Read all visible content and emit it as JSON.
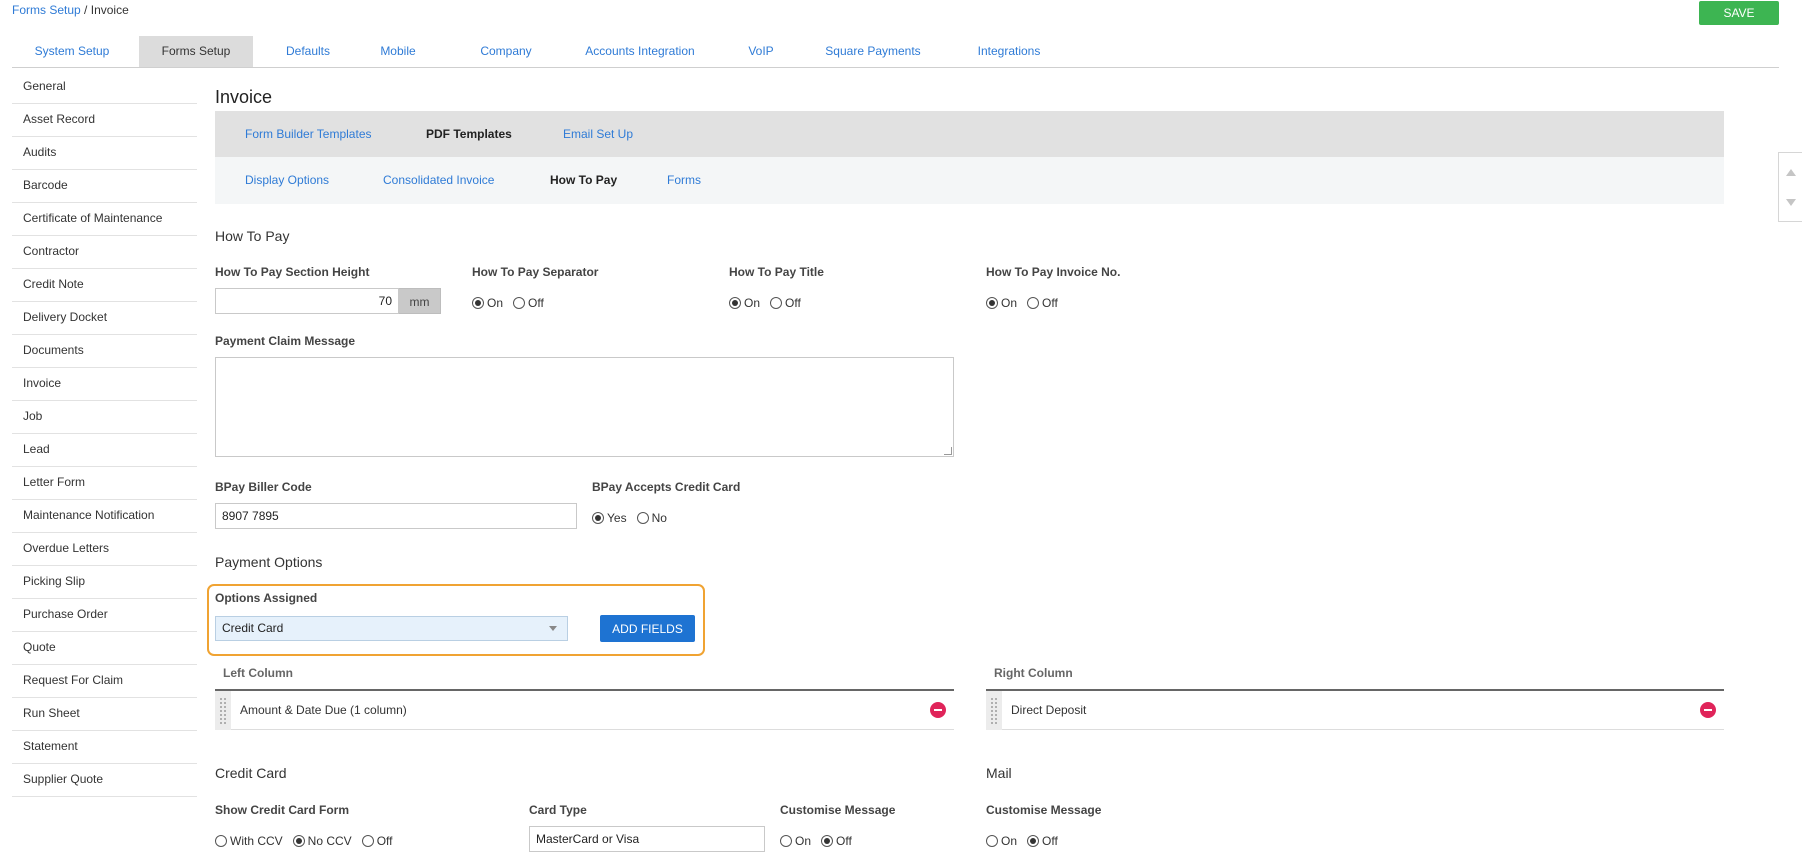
{
  "breadcrumb": {
    "parent": "Forms Setup",
    "separator": "/",
    "current": "Invoice"
  },
  "save_label": "SAVE",
  "main_tabs": [
    {
      "label": "System Setup",
      "active": false
    },
    {
      "label": "Forms Setup",
      "active": true
    },
    {
      "label": "Defaults",
      "active": false
    },
    {
      "label": "Mobile",
      "active": false
    },
    {
      "label": "Company",
      "active": false
    },
    {
      "label": "Accounts Integration",
      "active": false
    },
    {
      "label": "VoIP",
      "active": false
    },
    {
      "label": "Square Payments",
      "active": false
    },
    {
      "label": "Integrations",
      "active": false
    }
  ],
  "sidebar": {
    "items": [
      {
        "label": "General"
      },
      {
        "label": "Asset Record"
      },
      {
        "label": "Audits"
      },
      {
        "label": "Barcode"
      },
      {
        "label": "Certificate of Maintenance"
      },
      {
        "label": "Contractor"
      },
      {
        "label": "Credit Note"
      },
      {
        "label": "Delivery Docket"
      },
      {
        "label": "Documents"
      },
      {
        "label": "Invoice"
      },
      {
        "label": "Job"
      },
      {
        "label": "Lead"
      },
      {
        "label": "Letter Form"
      },
      {
        "label": "Maintenance Notification"
      },
      {
        "label": "Overdue Letters"
      },
      {
        "label": "Picking Slip"
      },
      {
        "label": "Purchase Order"
      },
      {
        "label": "Quote"
      },
      {
        "label": "Request For Claim"
      },
      {
        "label": "Run Sheet"
      },
      {
        "label": "Statement"
      },
      {
        "label": "Supplier Quote"
      }
    ]
  },
  "page_title": "Invoice",
  "sub_tabs": [
    {
      "label": "Form Builder Templates",
      "active": false
    },
    {
      "label": "PDF Templates",
      "active": true
    },
    {
      "label": "Email Set Up",
      "active": false
    }
  ],
  "sub_tabs_2": [
    {
      "label": "Display Options",
      "active": false
    },
    {
      "label": "Consolidated Invoice",
      "active": false
    },
    {
      "label": "How To Pay",
      "active": true
    },
    {
      "label": "Forms",
      "active": false
    }
  ],
  "how_to_pay": {
    "heading": "How To Pay",
    "section_height": {
      "label": "How To Pay Section Height",
      "value": "70",
      "unit": "mm"
    },
    "separator": {
      "label": "How To Pay Separator",
      "on": "On",
      "off": "Off",
      "selected": "on"
    },
    "title": {
      "label": "How To Pay Title",
      "on": "On",
      "off": "Off",
      "selected": "on"
    },
    "invoice_no": {
      "label": "How To Pay Invoice No.",
      "on": "On",
      "off": "Off",
      "selected": "on"
    },
    "payment_claim_message": {
      "label": "Payment Claim Message",
      "value": ""
    },
    "bpay_biller_code": {
      "label": "BPay Biller Code",
      "value": "8907 7895"
    },
    "bpay_accepts_credit_card": {
      "label": "BPay Accepts Credit Card",
      "yes": "Yes",
      "no": "No",
      "selected": "yes"
    }
  },
  "payment_options": {
    "heading": "Payment Options",
    "options_assigned_label": "Options Assigned",
    "selected_option": "Credit Card",
    "add_fields_label": "ADD FIELDS",
    "left_column": {
      "title": "Left Column",
      "items": [
        {
          "label": "Amount & Date Due (1 column)"
        }
      ]
    },
    "right_column": {
      "title": "Right Column",
      "items": [
        {
          "label": "Direct Deposit"
        }
      ]
    }
  },
  "credit_card": {
    "heading": "Credit Card",
    "show_form": {
      "label": "Show Credit Card Form",
      "options": [
        "With CCV",
        "No CCV",
        "Off"
      ],
      "selected": 1
    },
    "card_type": {
      "label": "Card Type",
      "value": "MasterCard or Visa"
    },
    "customise_message": {
      "label": "Customise Message",
      "on": "On",
      "off": "Off",
      "selected": "off"
    }
  },
  "mail": {
    "heading": "Mail",
    "customise_message": {
      "label": "Customise Message",
      "on": "On",
      "off": "Off",
      "selected": "off"
    }
  },
  "colors": {
    "accent_blue": "#2f7bd6",
    "save_green": "#3db552",
    "button_blue": "#1e73d2",
    "highlight_orange": "#f0a332",
    "remove_red": "#e0245a"
  }
}
